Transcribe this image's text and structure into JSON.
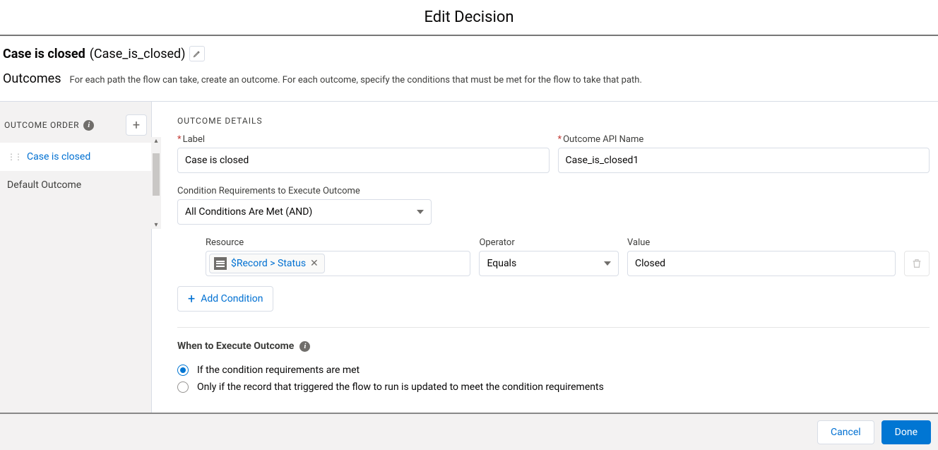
{
  "header": {
    "title": "Edit Decision"
  },
  "decision": {
    "label": "Case is closed",
    "api": "(Case_is_closed)"
  },
  "outcomes_section": {
    "heading": "Outcomes",
    "description": "For each path the flow can take, create an outcome. For each outcome, specify the conditions that must be met for the flow to take that path."
  },
  "sidebar": {
    "order_label": "OUTCOME ORDER",
    "items": [
      {
        "label": "Case is closed",
        "active": true
      },
      {
        "label": "Default Outcome",
        "active": false
      }
    ]
  },
  "details": {
    "heading": "OUTCOME DETAILS",
    "label_field": {
      "label": "Label",
      "value": "Case is closed"
    },
    "api_field": {
      "label": "Outcome API Name",
      "value": "Case_is_closed1"
    },
    "cond_req": {
      "label": "Condition Requirements to Execute Outcome",
      "value": "All Conditions Are Met (AND)"
    },
    "condition": {
      "resource_label": "Resource",
      "resource_value": "$Record > Status",
      "operator_label": "Operator",
      "operator_value": "Equals",
      "value_label": "Value",
      "value_value": "Closed"
    },
    "add_condition": "Add Condition",
    "execute": {
      "heading": "When to Execute Outcome",
      "opt1": "If the condition requirements are met",
      "opt2": "Only if the record that triggered the flow to run is updated to meet the condition requirements"
    }
  },
  "footer": {
    "cancel": "Cancel",
    "done": "Done"
  }
}
